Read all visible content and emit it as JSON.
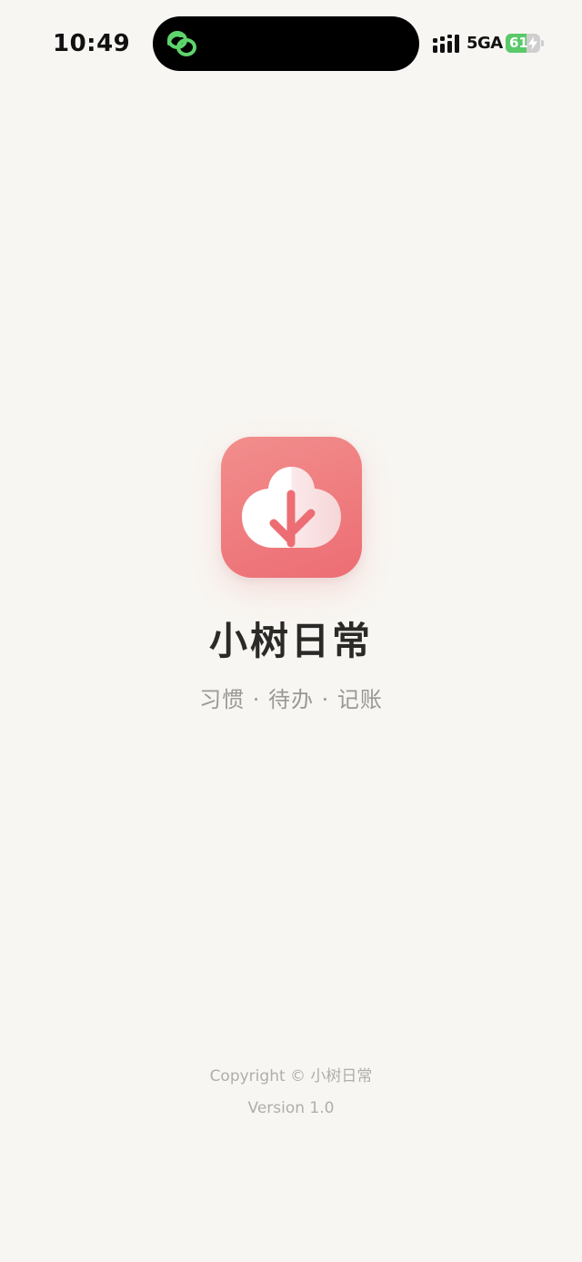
{
  "status_bar": {
    "time": "10:49",
    "network": "5GA",
    "battery_percent": "61",
    "battery_level": 0.61,
    "island_icon": "link-rings-icon",
    "signal_icon": "signal-bars-icon",
    "charging_icon": "bolt-icon"
  },
  "splash": {
    "app_name": "小树日常",
    "tagline": "习惯 · 待办 · 记账",
    "logo_icon": "cloud-tree-icon",
    "copyright": "Copyright © 小树日常",
    "version": "Version 1.0"
  },
  "colors": {
    "background": "#f8f6f2",
    "brand": "#ec6d73",
    "battery": "#5ac96a",
    "island_accent": "#5fd36d"
  }
}
